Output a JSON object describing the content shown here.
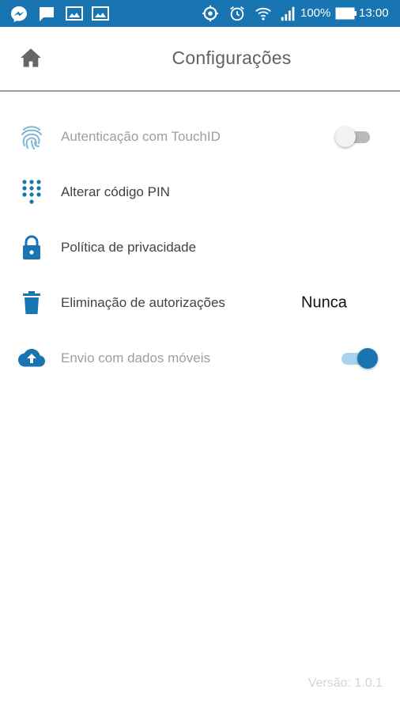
{
  "status_bar": {
    "battery": "100%",
    "time": "13:00",
    "left_icons": [
      "messenger-icon",
      "chat-icon",
      "image-icon",
      "image-icon"
    ],
    "right_icons": [
      "sync-icon",
      "alarm-icon",
      "wifi-icon",
      "signal-icon",
      "battery-icon"
    ]
  },
  "header": {
    "title": "Configurações",
    "home_icon": "home-icon"
  },
  "settings": {
    "items": [
      {
        "label": "Autenticação com TouchID",
        "icon": "fingerprint-icon",
        "enabled": false,
        "toggle": "off"
      },
      {
        "label": "Alterar código PIN",
        "icon": "dialpad-icon",
        "enabled": true
      },
      {
        "label": "Política de privacidade",
        "icon": "lock-icon",
        "enabled": true
      },
      {
        "label": "Eliminação de autorizações",
        "icon": "trash-icon",
        "enabled": true,
        "value": "Nunca"
      },
      {
        "label": "Envio com dados móveis",
        "icon": "cloud-upload-icon",
        "enabled": false,
        "toggle": "on"
      }
    ]
  },
  "footer": {
    "version": "Versão: 1.0.1"
  },
  "colors": {
    "accent": "#1875b2",
    "toggle_on_track": "#a9d3ec",
    "disabled_text": "#9e9e9e"
  }
}
